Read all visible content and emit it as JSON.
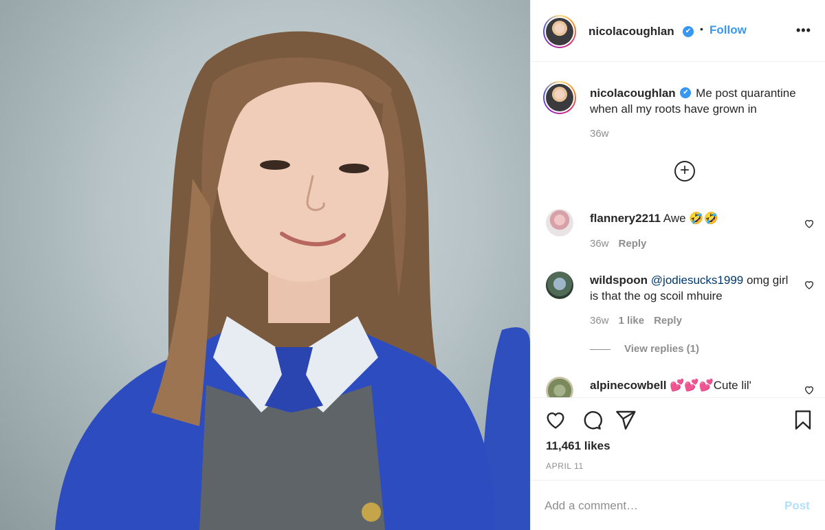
{
  "post": {
    "image_alt": "School photo of a girl in a blue cardigan and tie"
  },
  "header": {
    "username": "nicolacoughlan",
    "verified_icon": "✔",
    "separator": "•",
    "follow_label": "Follow",
    "more_label": "•••"
  },
  "caption": {
    "username": "nicolacoughlan",
    "verified_icon": "✔",
    "text": " Me post quarantine when all my roots have grown in",
    "time": "36w"
  },
  "load_more_label": "+",
  "comments": [
    {
      "username": "flannery2211",
      "text": " Awe 🤣🤣",
      "time": "36w",
      "likes": "",
      "reply_label": "Reply"
    },
    {
      "username": "wildspoon",
      "mention": "@jodiesucks1999",
      "text": " omg girl is that the og scoil mhuire",
      "time": "36w",
      "likes": "1 like",
      "reply_label": "Reply",
      "view_replies": "View replies (1)"
    },
    {
      "username": "alpinecowbell",
      "text": " 💕💕💕Cute lil'"
    }
  ],
  "actions": {
    "likes": "11,461 likes",
    "date": "APRIL 11"
  },
  "add_comment": {
    "placeholder": "Add a comment…",
    "post_label": "Post"
  },
  "colors": {
    "accent": "#3897f0",
    "post_disabled": "#b2dffc",
    "muted": "#8e8e8e"
  }
}
